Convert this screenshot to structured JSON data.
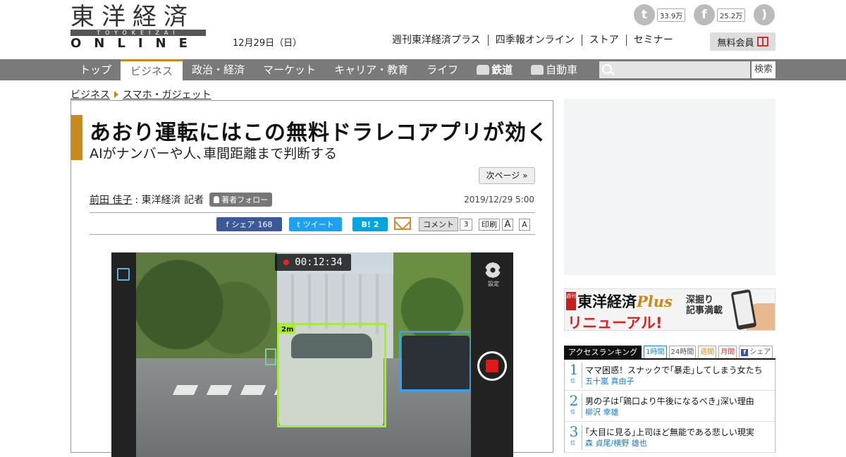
{
  "header": {
    "logo_kanji": "東洋経済",
    "logo_romaji": "TOYOKEIZAI",
    "logo_online": "ONLINE",
    "date": "12月29日（日）",
    "social": [
      {
        "name": "twitter",
        "glyph": "t",
        "count": "33.9万"
      },
      {
        "name": "facebook",
        "glyph": "f",
        "count": "25.2万"
      },
      {
        "name": "rss",
        "glyph": ")",
        "count": ""
      }
    ],
    "links": [
      "週刊東洋経済プラス",
      "四季報オンライン",
      "ストア",
      "セミナー"
    ],
    "member_label": "無料会員"
  },
  "nav": {
    "items": [
      {
        "label": "トップ",
        "active": false
      },
      {
        "label": "ビジネス",
        "active": true
      },
      {
        "label": "政治・経済",
        "active": false
      },
      {
        "label": "マーケット",
        "active": false
      },
      {
        "label": "キャリア・教育",
        "active": false
      },
      {
        "label": "ライフ",
        "active": false
      },
      {
        "label": "鉄道",
        "active": false,
        "icon": "train-icon"
      },
      {
        "label": "自動車",
        "active": false,
        "icon": "car-icon"
      }
    ],
    "search_placeholder": "",
    "search_button": "検索"
  },
  "breadcrumb": [
    "ビジネス",
    "スマホ・ガジェット"
  ],
  "article": {
    "title": "あおり運転にはこの無料ドラレコアプリが効く",
    "subtitle": "AIがナンバーや人､車間距離まで判断する",
    "next_label": "次ページ »",
    "author_name": "前田 佳子",
    "author_affil": ": 東洋経済 記者",
    "follow_label": "著者フォロー",
    "pubdate": "2019/12/29 5:00",
    "share": {
      "fb_label": "シェア",
      "fb_count": "168",
      "tw_label": "ツイート",
      "hb_label": "B!",
      "hb_count": "2",
      "comment_label": "コメント",
      "comment_count": "3",
      "print_label": "印刷",
      "font_large": "A",
      "font_small": "A"
    },
    "image": {
      "timer": "00:12:34",
      "distance_tag": "2m",
      "settings_label": "設定"
    }
  },
  "sidebar": {
    "banner": {
      "tag": "週刊",
      "line1_a": "東洋経済",
      "line1_b": "Plus",
      "line2": "リニューアル!",
      "line3a": "深掘り",
      "line3b": "記事満載"
    },
    "ranking": {
      "title": "アクセスランキング",
      "tabs": [
        "1時間",
        "24時間",
        "週間",
        "月間",
        "シェア"
      ],
      "items": [
        {
          "num": "1",
          "suffix": "位",
          "headline": "ママ困惑！スナックで｢暴走｣してしまう女たち",
          "author": "五十嵐 真由子"
        },
        {
          "num": "2",
          "suffix": "位",
          "headline": "男の子は｢鶏口より牛後になるべき｣深い理由",
          "author": "柳沢 幸雄"
        },
        {
          "num": "3",
          "suffix": "位",
          "headline": "｢大目に見る｣上司ほど無能である悲しい現実",
          "author": "森 貞尾/横野 雄也"
        }
      ]
    }
  }
}
